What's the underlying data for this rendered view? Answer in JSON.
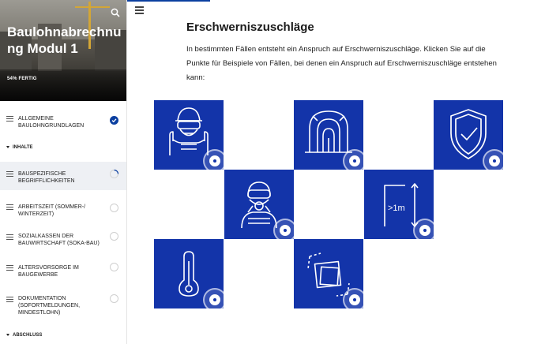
{
  "course": {
    "title": "Baulohnabrechnung Modul 1",
    "progress_label": "54% FERTIG"
  },
  "sidebar": {
    "items": [
      {
        "label": "ALLGEMEINE BAULOHNGRUNDLAGEN",
        "status": "completed"
      },
      {
        "label": "BAUSPEZIFISCHE BEGRIFFLICHKEITEN",
        "status": "in-progress"
      },
      {
        "label": "ARBEITSZEIT (SOMMER-/ WINTERZEIT)",
        "status": "not-started"
      },
      {
        "label": "SOZIALKASSEN DER BAUWIRTSCHAFT (SOKA-BAU)",
        "status": "not-started"
      },
      {
        "label": "ALTERSVORSORGE IM BAUGEWERBE",
        "status": "not-started"
      },
      {
        "label": "DOKUMENTATION (SOFORTMELDUNGEN, MINDESTLOHN)",
        "status": "not-started"
      }
    ],
    "sections": {
      "inhalte": "INHALTE",
      "abschluss": "ABSCHLUSS"
    }
  },
  "main": {
    "title": "Erschwerniszuschläge",
    "intro": "In bestimmten Fällen entsteht ein Anspruch auf Erschwerniszuschläge. Klicken Sie auf die Punkte für Beispiele von Fällen, bei denen ein Anspruch auf Erschwerniszuschläge entstehen kann:",
    "tiles": [
      {
        "icon": "worker-protective-gear-icon"
      },
      {
        "icon": "tunnel-icon"
      },
      {
        "icon": "shield-check-icon"
      },
      {
        "icon": "diver-icon"
      },
      {
        "icon": "height-icon",
        "text": ">1m"
      },
      {
        "icon": "thermometer-icon"
      },
      {
        "icon": "tilted-squares-icon"
      }
    ]
  },
  "colors": {
    "accent": "#1334a9",
    "nav_accent": "#0b3fa0"
  }
}
